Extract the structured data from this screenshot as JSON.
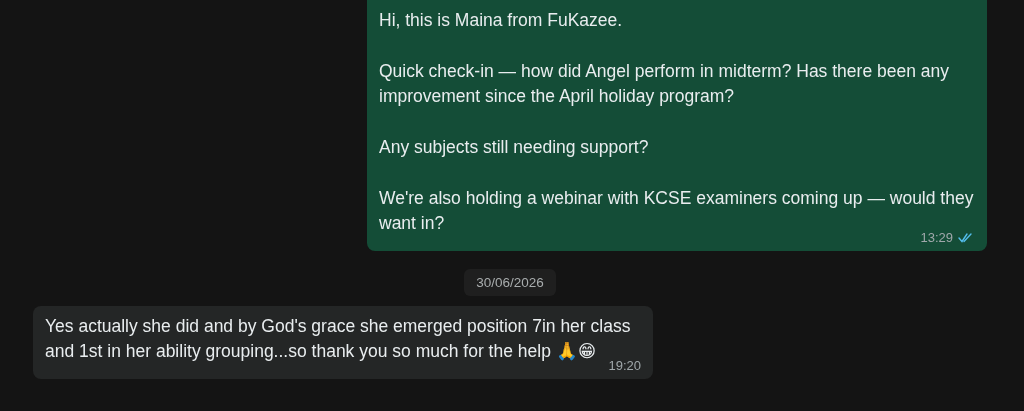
{
  "messages": [
    {
      "kind": "outgoing",
      "paragraphs": [
        "Hi, this is Maina from FuKazee.",
        "Quick check-in — how did Angel perform in midterm? Has there been any improvement since the April holiday program?",
        "Any subjects still needing support?",
        "We're also holding a webinar with KCSE examiners coming up — would they want in?"
      ],
      "time": "13:29",
      "read": true
    },
    {
      "kind": "date",
      "label": "30/06/2026"
    },
    {
      "kind": "incoming",
      "paragraphs": [
        "Yes actually she did and by God's grace she emerged position 7in her class and 1st in her ability grouping...so thank you so much for the help 🙏😁"
      ],
      "time": "19:20"
    }
  ]
}
